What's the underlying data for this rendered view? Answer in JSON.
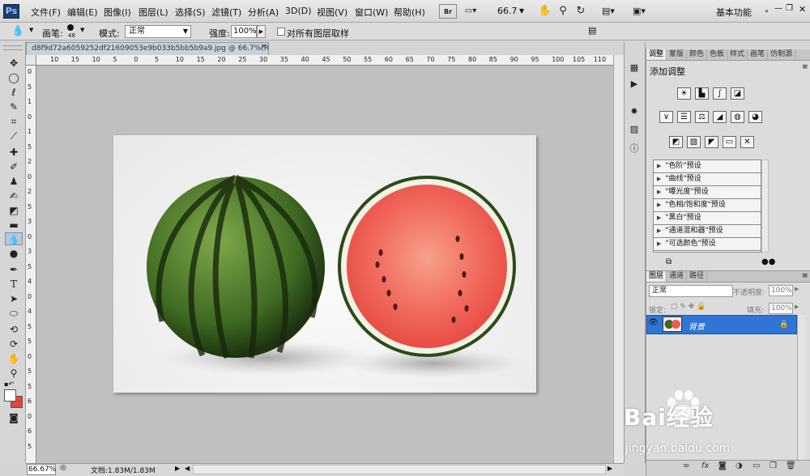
{
  "app": {
    "logo": "Ps"
  },
  "menu": [
    "文件(F)",
    "编辑(E)",
    "图像(I)",
    "图层(L)",
    "选择(S)",
    "滤镜(T)",
    "分析(A)",
    "3D(D)",
    "视图(V)",
    "窗口(W)",
    "帮助(H)"
  ],
  "menubar_tools": {
    "zoom_value": "66.7",
    "workspace": "基本功能"
  },
  "icons": {
    "br": "br-icon",
    "mb": "mini-bridge-icon",
    "hand": "hand-icon",
    "zoom": "zoom-icon",
    "rotate": "rotate-view-icon",
    "arrange": "arrange-documents-icon",
    "screen": "screen-mode-icon"
  },
  "options": {
    "brush_label": "画笔:",
    "brush_size": "48",
    "mode_label": "模式:",
    "mode_value": "正常",
    "strength_label": "强度:",
    "strength_value": "100%",
    "sample_all_label": "对所有图层取样"
  },
  "document": {
    "tab_title": "d8f9d72a6059252df21609053e9b033b5bb5b9a9.jpg @ 66.7%(RGB/8) *",
    "ruler_top": [
      "10",
      "15",
      "10",
      "5",
      "0",
      "5",
      "10",
      "15",
      "20",
      "25",
      "30",
      "35",
      "40",
      "45",
      "50",
      "55",
      "60",
      "65",
      "70",
      "75",
      "80",
      "85",
      "90",
      "95",
      "100",
      "105",
      "110",
      "115"
    ],
    "ruler_left": [
      "0",
      "5",
      "1",
      "0",
      "1",
      "5",
      "2",
      "0",
      "2",
      "5",
      "3",
      "0",
      "3",
      "5",
      "4",
      "0",
      "4",
      "5",
      "5",
      "0",
      "5",
      "5",
      "6",
      "0",
      "6",
      "5"
    ]
  },
  "status": {
    "zoom": "66.67%",
    "doc_info": "文档:1.83M/1.83M"
  },
  "adjust_panel": {
    "tabs": [
      "调整",
      "蒙版",
      "颜色",
      "色板",
      "样式",
      "画笔",
      "仿制源"
    ],
    "title": "添加调整",
    "presets": [
      "\"色阶\"预设",
      "\"曲线\"预设",
      "\"曝光度\"预设",
      "\"色相/饱和度\"预设",
      "\"黑白\"预设",
      "\"通道混和器\"预设",
      "\"可选颜色\"预设"
    ]
  },
  "layers_panel": {
    "tabs": [
      "图层",
      "通道",
      "路径"
    ],
    "blend_mode": "正常",
    "opacity_label": "不透明度:",
    "opacity_value": "100%",
    "lock_label": "锁定:",
    "fill_label": "填充:",
    "fill_value": "100%",
    "layer_name": "背景"
  },
  "watermark": {
    "main": "Bai经验",
    "sub": "jingyan.baidu.com"
  }
}
